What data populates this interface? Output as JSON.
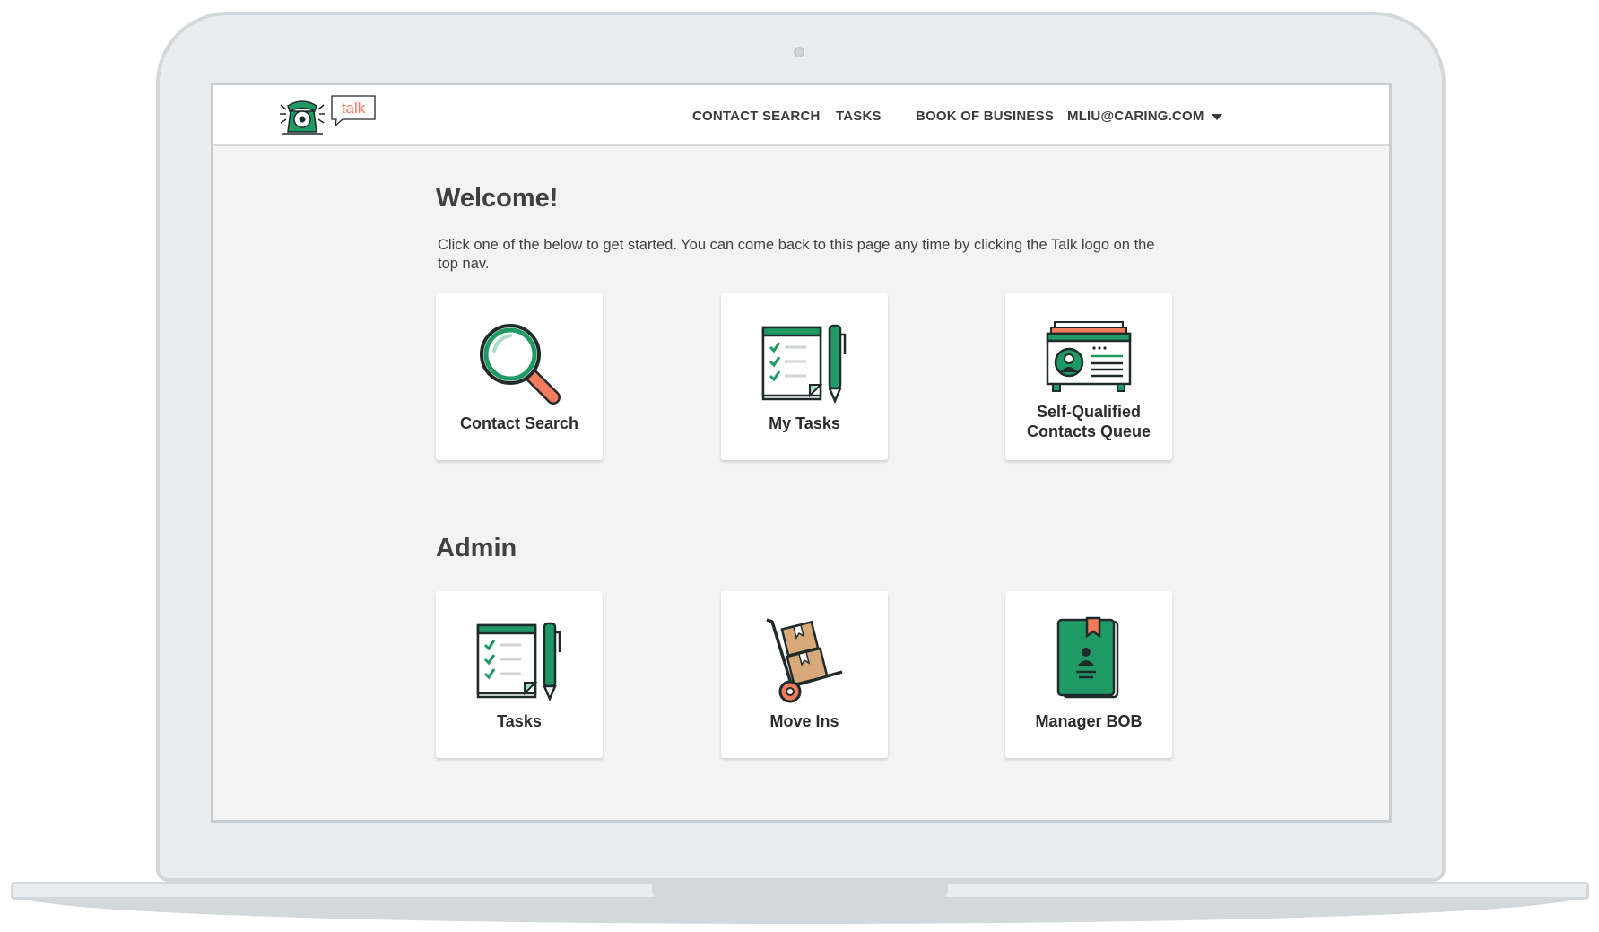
{
  "logo": {
    "text": "talk"
  },
  "nav": {
    "contact_search": "CONTACT SEARCH",
    "tasks": "TASKS",
    "book_of_business": "BOOK OF BUSINESS",
    "user": "MLIU@CARING.COM"
  },
  "welcome": {
    "title": "Welcome!",
    "intro": "Click one of the below to get started. You can come back to this page any time by clicking the Talk logo on the top nav."
  },
  "cards": {
    "contact_search": "Contact Search",
    "my_tasks": "My Tasks",
    "self_qualified": "Self-Qualified Contacts Queue"
  },
  "admin": {
    "title": "Admin",
    "tasks": "Tasks",
    "move_ins": "Move Ins",
    "manager_bob": "Manager BOB"
  },
  "colors": {
    "brand_green": "#1f9a64",
    "accent_orange": "#f47b5c",
    "outline": "#1f2a2a",
    "page_bg": "#f3f3f3"
  }
}
